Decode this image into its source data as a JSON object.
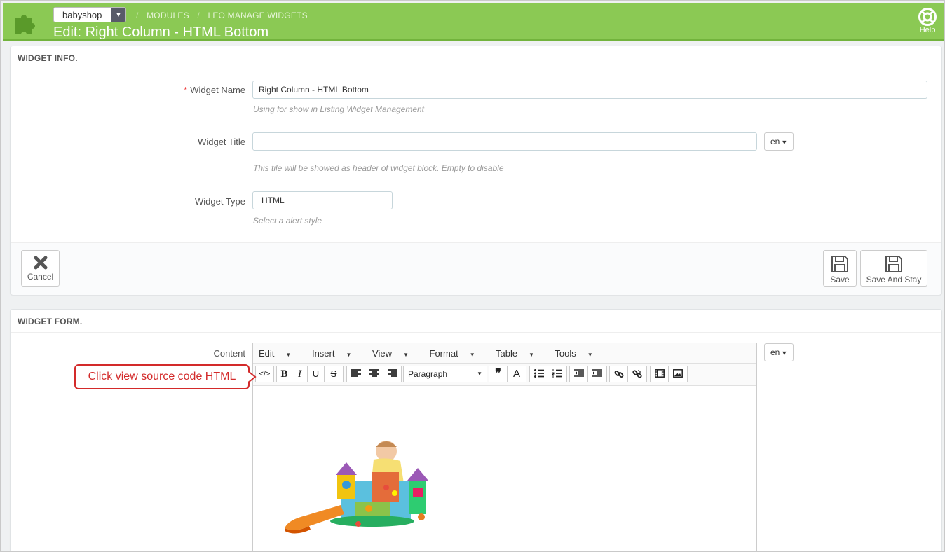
{
  "header": {
    "shop_select": "babyshop",
    "breadcrumb": [
      "MODULES",
      "LEO MANAGE WIDGETS"
    ],
    "title": "Edit: Right Column - HTML Bottom",
    "help_label": "Help",
    "color": "#8bc954"
  },
  "widget_info": {
    "heading": "WIDGET INFO.",
    "name_label": "Widget Name",
    "name_value": "Right Column - HTML Bottom",
    "name_hint": "Using for show in Listing Widget Management",
    "title_label": "Widget Title",
    "title_value": "",
    "title_lang": "en",
    "title_hint": "This tile will be showed as header of widget block. Empty to disable",
    "type_label": "Widget Type",
    "type_value": "HTML",
    "type_hint": "Select a alert style",
    "cancel_label": "Cancel",
    "save_label": "Save",
    "save_stay_label": "Save And Stay"
  },
  "widget_form": {
    "heading": "WIDGET FORM.",
    "content_label": "Content",
    "content_lang": "en",
    "menus": [
      "Edit",
      "Insert",
      "View",
      "Format",
      "Table",
      "Tools"
    ],
    "block_format": "Paragraph"
  },
  "callout": {
    "text": "Click view source code HTML",
    "color": "#d32a2a"
  }
}
